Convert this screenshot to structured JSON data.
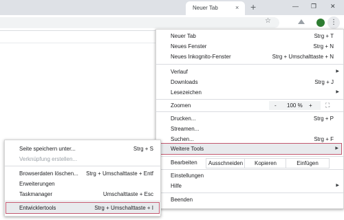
{
  "tab": {
    "title": "Neuer Tab",
    "close": "×"
  },
  "newtab": "+",
  "window": {
    "minimize": "—",
    "restore": "❐",
    "close": "✕"
  },
  "toolbar": {
    "star": "☆",
    "menu": "⋮"
  },
  "menu": {
    "new_tab": {
      "label": "Neuer Tab",
      "shortcut": "Strg + T"
    },
    "new_window": {
      "label": "Neues Fenster",
      "shortcut": "Strg + N"
    },
    "new_incognito": {
      "label": "Neues Inkognito-Fenster",
      "shortcut": "Strg + Umschalttaste + N"
    },
    "history": {
      "label": "Verlauf",
      "arrow": "▶"
    },
    "downloads": {
      "label": "Downloads",
      "shortcut": "Strg + J"
    },
    "bookmarks": {
      "label": "Lesezeichen",
      "arrow": "▶"
    },
    "zoom": {
      "label": "Zoomen",
      "minus": "-",
      "value": "100 %",
      "plus": "+",
      "fullscreen": "⛶"
    },
    "print": {
      "label": "Drucken...",
      "shortcut": "Strg + P"
    },
    "cast": {
      "label": "Streamen..."
    },
    "find": {
      "label": "Suchen...",
      "shortcut": "Strg + F"
    },
    "more_tools": {
      "label": "Weitere Tools",
      "arrow": "▶"
    },
    "edit": {
      "label": "Bearbeiten",
      "cut": "Ausschneiden",
      "copy": "Kopieren",
      "paste": "Einfügen"
    },
    "settings": {
      "label": "Einstellungen"
    },
    "help": {
      "label": "Hilfe",
      "arrow": "▶"
    },
    "exit": {
      "label": "Beenden"
    }
  },
  "submenu": {
    "save_page": {
      "label": "Seite speichern unter...",
      "shortcut": "Strg + S"
    },
    "create_shortcut": {
      "label": "Verknüpfung erstellen..."
    },
    "clear_data": {
      "label": "Browserdaten löschen...",
      "shortcut": "Strg + Umschalttaste + Entf"
    },
    "extensions": {
      "label": "Erweiterungen"
    },
    "task_manager": {
      "label": "Taskmanager",
      "shortcut": "Umschalttaste + Esc"
    },
    "dev_tools": {
      "label": "Entwicklertools",
      "shortcut": "Strg + Umschalttaste + I"
    }
  },
  "colors": {
    "highlight_outline": "#c2566e",
    "avatar": "#2e7d32"
  }
}
